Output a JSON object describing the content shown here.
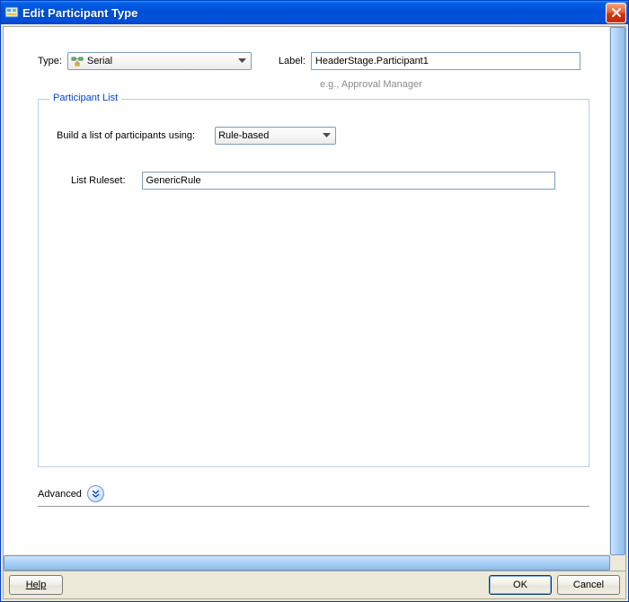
{
  "window": {
    "title": "Edit Participant Type"
  },
  "form": {
    "type_label": "Type:",
    "type_value": "Serial",
    "label_label": "Label:",
    "label_value": "HeaderStage.Participant1",
    "label_hint": "e.g., Approval Manager"
  },
  "participant_list": {
    "legend": "Participant List",
    "build_label": "Build a list of participants using:",
    "build_value": "Rule-based",
    "ruleset_label": "List Ruleset:",
    "ruleset_value": "GenericRule"
  },
  "advanced": {
    "label": "Advanced"
  },
  "buttons": {
    "help": "Help",
    "ok": "OK",
    "cancel": "Cancel"
  }
}
